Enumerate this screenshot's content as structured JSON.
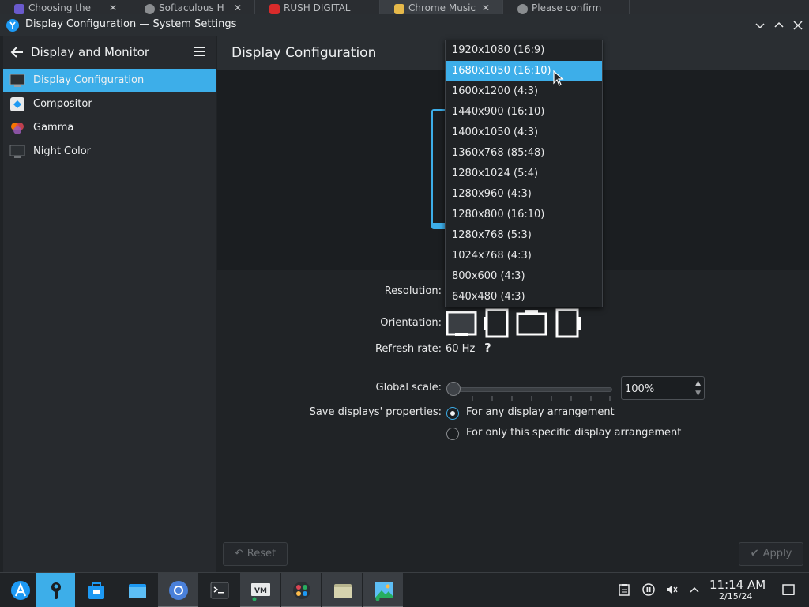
{
  "browser_tabs": [
    {
      "title": "Choosing the",
      "icon_color": "#6a5acd"
    },
    {
      "title": "Softaculous H",
      "icon_color": "#8a8d90"
    },
    {
      "title": "RUSH DIGITAL",
      "icon_color": "#d92b2b"
    },
    {
      "title": "Chrome Music",
      "icon_color": "#e6b94a"
    },
    {
      "title": "Please confirm",
      "icon_color": "#8a8d90"
    }
  ],
  "window": {
    "title": "Display Configuration — System Settings"
  },
  "sidebar": {
    "header_title": "Display and Monitor",
    "items": [
      {
        "label": "Display Configuration",
        "icon": "monitor-icon",
        "selected": true
      },
      {
        "label": "Compositor",
        "icon": "compositor-icon",
        "selected": false
      },
      {
        "label": "Gamma",
        "icon": "gamma-icon",
        "selected": false
      },
      {
        "label": "Night Color",
        "icon": "night-color-icon",
        "selected": false
      }
    ]
  },
  "main": {
    "title": "Display Configuration",
    "resolution_label": "Resolution:",
    "orientation_label": "Orientation:",
    "refresh_label": "Refresh rate:",
    "refresh_value": "60 Hz",
    "help_text": "?",
    "global_scale_label": "Global scale:",
    "global_scale_value": "100%",
    "save_label": "Save displays' properties:",
    "save_options": [
      {
        "label": "For any display arrangement",
        "checked": true
      },
      {
        "label": "For only this specific display arrangement",
        "checked": false
      }
    ],
    "reset_label": "Reset",
    "apply_label": "Apply"
  },
  "resolution_dropdown": {
    "highlighted_index": 1,
    "options": [
      "1920x1080 (16:9)",
      "1680x1050 (16:10)",
      "1600x1200 (4:3)",
      "1440x900 (16:10)",
      "1400x1050 (4:3)",
      "1360x768 (85:48)",
      "1280x1024 (5:4)",
      "1280x960 (4:3)",
      "1280x800 (16:10)",
      "1280x768 (5:3)",
      "1024x768 (4:3)",
      "800x600 (4:3)",
      "640x480 (4:3)"
    ]
  },
  "taskbar": {
    "apps": [
      {
        "name": "application-launcher",
        "state": "normal"
      },
      {
        "name": "system-settings",
        "state": "active"
      },
      {
        "name": "discover",
        "state": "normal"
      },
      {
        "name": "file-manager",
        "state": "normal"
      },
      {
        "name": "chromium",
        "state": "running"
      },
      {
        "name": "terminal",
        "state": "normal"
      },
      {
        "name": "vm-manager",
        "state": "running"
      },
      {
        "name": "colors",
        "state": "running"
      },
      {
        "name": "folder",
        "state": "running"
      },
      {
        "name": "image-viewer",
        "state": "running"
      }
    ],
    "clock_time": "11:14 AM",
    "clock_date": "2/15/24"
  },
  "colors": {
    "accent": "#3daee9",
    "background": "#202326"
  }
}
